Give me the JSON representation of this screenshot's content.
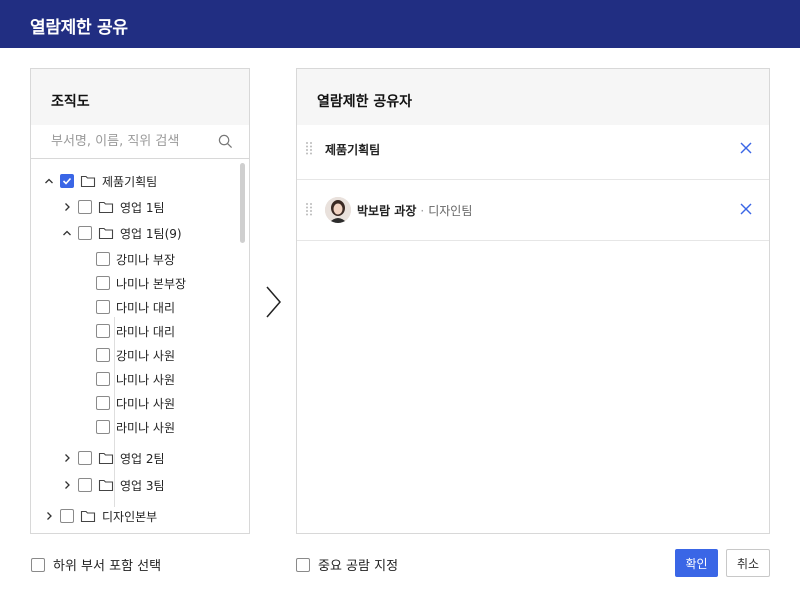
{
  "dialog": {
    "title": "열람제한 공유"
  },
  "org_panel": {
    "title": "조직도",
    "search_placeholder": "부서명, 이름, 직위 검색",
    "tree": [
      {
        "label": "제품기획팀",
        "level": 0,
        "expanded": true,
        "checked": true,
        "folder": true
      },
      {
        "label": "영업 1팀",
        "level": 1,
        "expanded": false,
        "checked": false,
        "folder": true
      },
      {
        "label": "영업 1팀(9)",
        "level": 1,
        "expanded": true,
        "checked": false,
        "folder": true
      },
      {
        "label": "강미나 부장",
        "level": 2,
        "checked": false
      },
      {
        "label": "나미나 본부장",
        "level": 2,
        "checked": false
      },
      {
        "label": "다미나 대리",
        "level": 2,
        "checked": false
      },
      {
        "label": "라미나 대리",
        "level": 2,
        "checked": false
      },
      {
        "label": "강미나 사원",
        "level": 2,
        "checked": false
      },
      {
        "label": "나미나 사원",
        "level": 2,
        "checked": false
      },
      {
        "label": "다미나 사원",
        "level": 2,
        "checked": false
      },
      {
        "label": "라미나 사원",
        "level": 2,
        "checked": false
      },
      {
        "label": "영업 2팀",
        "level": 1,
        "expanded": false,
        "checked": false,
        "folder": true
      },
      {
        "label": "영업 3팀",
        "level": 1,
        "expanded": false,
        "checked": false,
        "folder": true
      },
      {
        "label": "디자인본부",
        "level": 0,
        "expanded": false,
        "checked": false,
        "folder": true
      }
    ]
  },
  "share_panel": {
    "title": "열람제한 공유자",
    "items": [
      {
        "type": "team",
        "name": "제품기획팀"
      },
      {
        "type": "person",
        "name": "박보람 과장",
        "separator": "·",
        "dept": "디자인팀"
      }
    ]
  },
  "footer": {
    "include_sub_label": "하위 부서 포함 선택",
    "important_label": "중요 공람 지정",
    "ok_label": "확인",
    "cancel_label": "취소"
  },
  "colors": {
    "header_bg": "#212e82",
    "accent": "#3a66e6"
  }
}
